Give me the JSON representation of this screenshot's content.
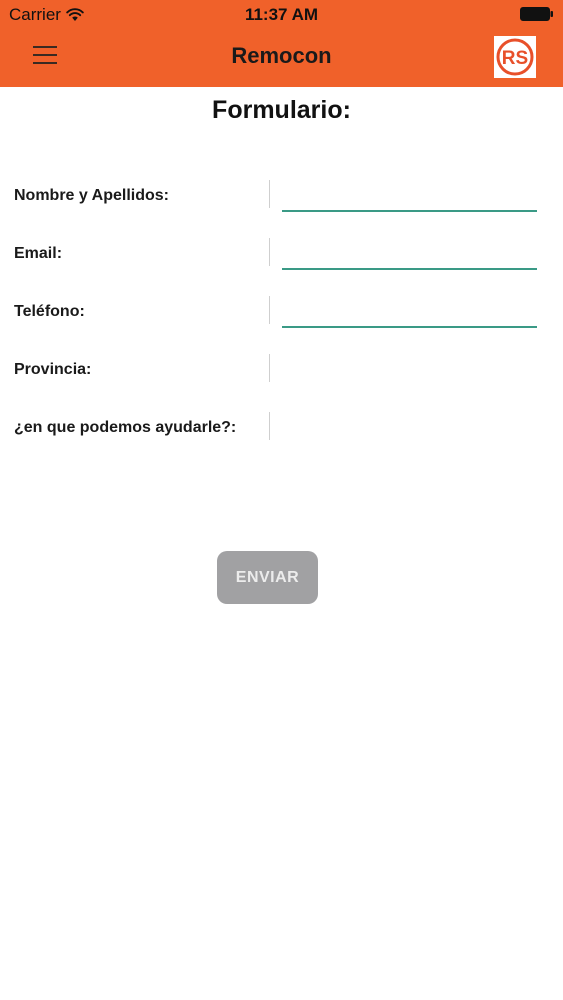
{
  "status_bar": {
    "carrier": "Carrier",
    "time": "11:37 AM",
    "wifi_icon": "wifi-icon",
    "battery_icon": "battery-icon"
  },
  "nav_bar": {
    "title": "Remocon",
    "menu_icon": "hamburger-menu-icon",
    "logo_text": "RS",
    "background_color": "#f0612a"
  },
  "form": {
    "title": "Formulario:",
    "fields": [
      {
        "label": "Nombre y Apellidos:",
        "value": "",
        "type": "text"
      },
      {
        "label": "Email:",
        "value": "",
        "type": "text"
      },
      {
        "label": "Teléfono:",
        "value": "",
        "type": "text"
      },
      {
        "label": "Provincia:",
        "value": "",
        "type": "picker"
      },
      {
        "label": "¿en que podemos ayudarle?:",
        "value": "",
        "type": "picker"
      }
    ],
    "submit_label": "ENVIAR",
    "underline_color": "#3a9a86"
  }
}
